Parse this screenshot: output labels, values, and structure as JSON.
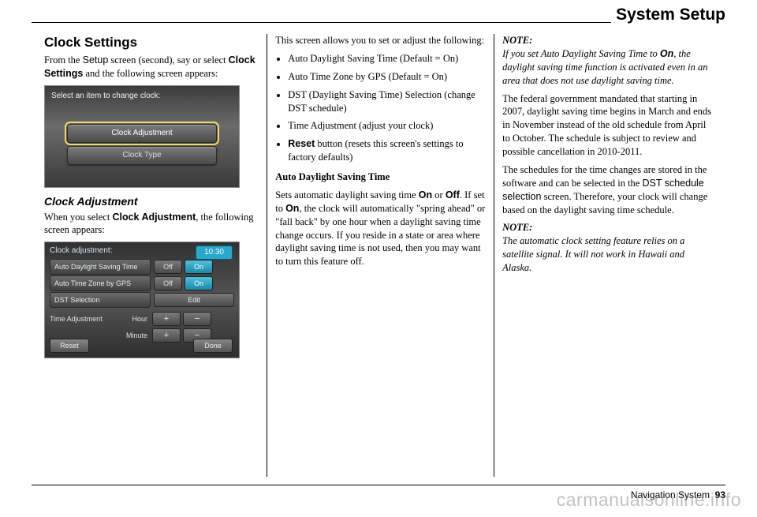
{
  "header": "System Setup",
  "footer_label": "Navigation System",
  "footer_page": "93",
  "watermark": "carmanualsonline.info",
  "col1": {
    "title": "Clock Settings",
    "intro_1": "From the ",
    "intro_setup": "Setup",
    "intro_2": " screen (second), say or select ",
    "intro_cs": "Clock Settings",
    "intro_3": " and the following screen appears:",
    "screen1_title": "Select an item to change clock:",
    "screen1_btn1": "Clock Adjustment",
    "screen1_btn2": "Clock Type",
    "sub1": "Clock Adjustment",
    "sub1_p1a": "When you select ",
    "sub1_p1b": "Clock Adjustment",
    "sub1_p1c": ", the following screen appears:",
    "s2": {
      "title": "Clock adjustment:",
      "clock": "10:30",
      "row1": "Auto Daylight Saving Time",
      "row2": "Auto Time Zone by GPS",
      "row3": "DST Selection",
      "off": "Off",
      "on": "On",
      "edit": "Edit",
      "adj": "Time Adjustment",
      "hour": "Hour",
      "minute": "Minute",
      "plus": "+",
      "minus": "−",
      "reset": "Reset",
      "done": "Done"
    }
  },
  "col2": {
    "lead": "This screen allows you to set or adjust the following:",
    "b1": "Auto Daylight Saving Time (Default = On)",
    "b2": "Auto Time Zone by GPS (Default = On)",
    "b3": "DST (Daylight Saving Time) Selection (change DST schedule)",
    "b4": "Time Adjustment (adjust your clock)",
    "b5a": "Reset",
    "b5b": " button (resets this screen's settings to factory defaults)",
    "h": "Auto Daylight Saving Time",
    "p1a": "Sets automatic daylight saving time ",
    "p1on": "On",
    "p1b": " or ",
    "p1off": "Off",
    "p1c": ". If set to ",
    "p1on2": "On",
    "p1d": ", the clock will automatically \"spring ahead\" or \"fall back\" by one hour when a daylight saving time change occurs. If you reside in a state or area where daylight saving time is not used, then you may want to turn this feature off."
  },
  "col3": {
    "note1_h": "NOTE:",
    "note1_a": "If you set Auto Daylight Saving Time to ",
    "note1_on": "On",
    "note1_b": ", the daylight saving time function is activated even in an area that does not use daylight saving time.",
    "p2": "The federal government mandated that starting in 2007, daylight saving time begins in March and ends in November instead of the old schedule from April to October. The schedule is subject to review and possible cancellation in 2010-2011.",
    "p3a": "The schedules for the time changes are stored in the software and can be selected in the ",
    "p3_dst": "DST schedule selection",
    "p3b": " screen. Therefore, your clock will change based on the daylight saving time schedule.",
    "note2_h": "NOTE:",
    "note2_body": "The automatic clock setting feature relies on a satellite signal. It will not work in Hawaii and Alaska."
  }
}
